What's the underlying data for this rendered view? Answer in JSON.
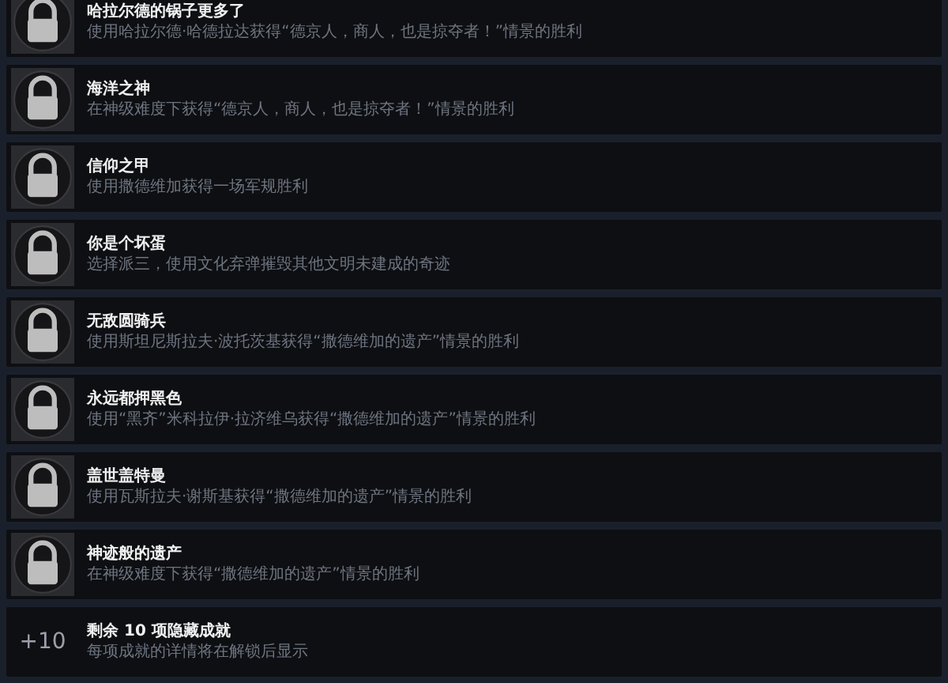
{
  "achievements": [
    {
      "kind": "achievement",
      "locked": true,
      "title": "哈拉尔德的锅子更多了",
      "description": "使用哈拉尔德·哈德拉达获得“德京人，商人，也是掠夺者！”情景的胜利"
    },
    {
      "kind": "achievement",
      "locked": true,
      "title": "海洋之神",
      "description": "在神级难度下获得“德京人，商人，也是掠夺者！”情景的胜利"
    },
    {
      "kind": "achievement",
      "locked": true,
      "title": "信仰之甲",
      "description": "使用撒德维加获得一场军规胜利"
    },
    {
      "kind": "achievement",
      "locked": true,
      "title": "你是个坏蛋",
      "description": "选择派三，使用文化弃弹摧毁其他文明未建成的奇迹"
    },
    {
      "kind": "achievement",
      "locked": true,
      "title": "无敌圆骑兵",
      "description": "使用斯坦尼斯拉夫·波托茨基获得“撒德维加的遗产”情景的胜利"
    },
    {
      "kind": "achievement",
      "locked": true,
      "title": "永远都押黑色",
      "description": "使用“黑齐”米科拉伊·拉济维乌获得“撒德维加的遗产”情景的胜利"
    },
    {
      "kind": "achievement",
      "locked": true,
      "title": "盖世盖特曼",
      "description": "使用瓦斯拉夫·谢斯基获得“撒德维加的遗产”情景的胜利"
    },
    {
      "kind": "achievement",
      "locked": true,
      "title": "神迹般的遗产",
      "description": "在神级难度下获得“撒德维加的遗产”情景的胜利"
    },
    {
      "kind": "hidden",
      "count": "+10",
      "title": "剩余 10 项隐藏成就",
      "description": "每项成就的详情将在解锁后显示"
    }
  ]
}
